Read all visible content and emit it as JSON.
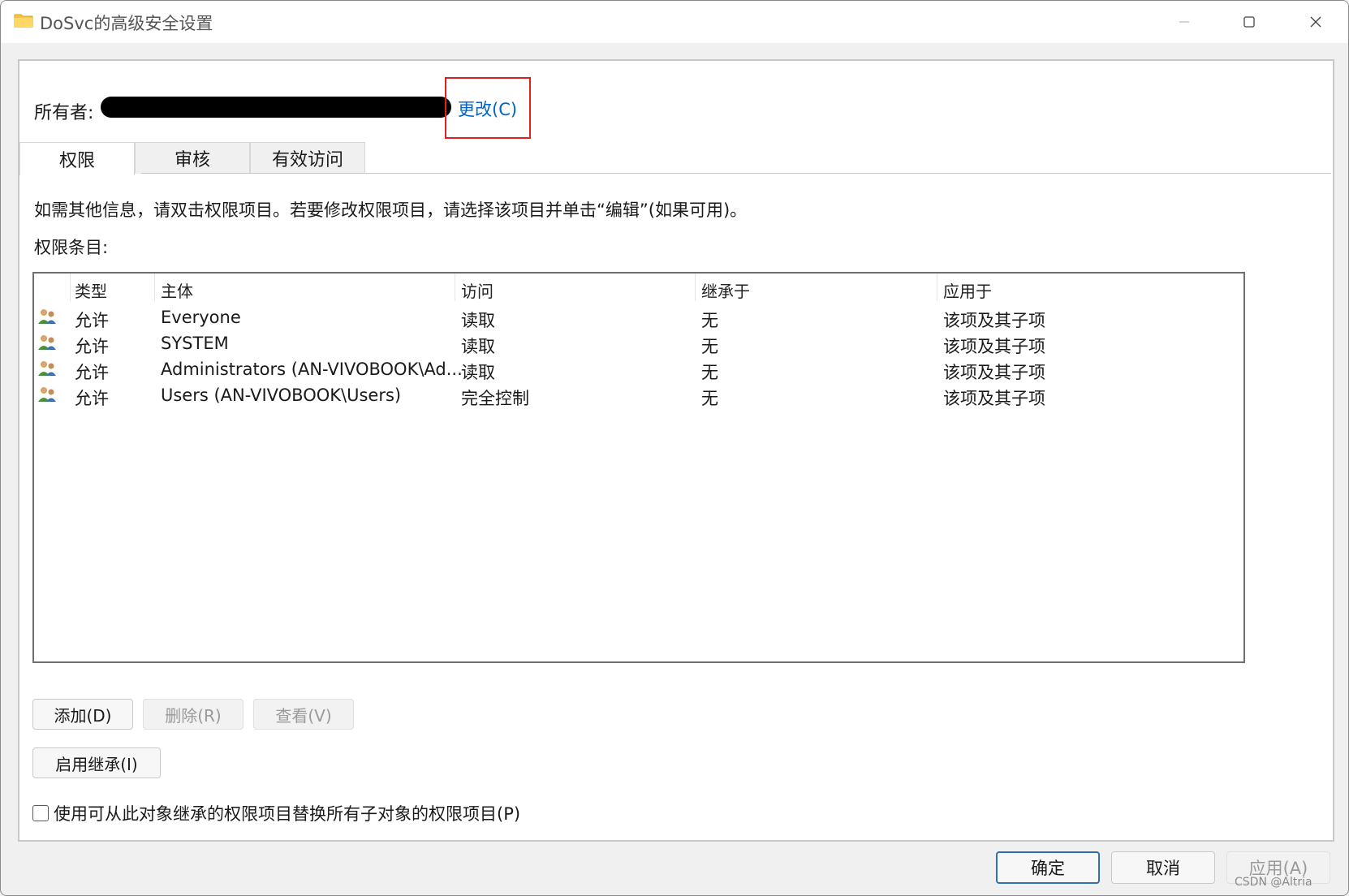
{
  "window": {
    "title": "DoSvc的高级安全设置"
  },
  "owner": {
    "label": "所有者:",
    "change_link": "更改(C)"
  },
  "tabs": [
    {
      "label": "权限",
      "active": true
    },
    {
      "label": "审核",
      "active": false
    },
    {
      "label": "有效访问",
      "active": false
    }
  ],
  "info_text": "如需其他信息，请双击权限项目。若要修改权限项目，请选择该项目并单击“编辑”(如果可用)。",
  "entries_label": "权限条目:",
  "table": {
    "columns": [
      "类型",
      "主体",
      "访问",
      "继承于",
      "应用于"
    ],
    "rows": [
      {
        "type": "允许",
        "principal": "Everyone",
        "access": "读取",
        "inherited": "无",
        "applies": "该项及其子项"
      },
      {
        "type": "允许",
        "principal": "SYSTEM",
        "access": "读取",
        "inherited": "无",
        "applies": "该项及其子项"
      },
      {
        "type": "允许",
        "principal": "Administrators (AN-VIVOBOOK\\Ad...",
        "access": "读取",
        "inherited": "无",
        "applies": "该项及其子项"
      },
      {
        "type": "允许",
        "principal": "Users (AN-VIVOBOOK\\Users)",
        "access": "完全控制",
        "inherited": "无",
        "applies": "该项及其子项"
      }
    ]
  },
  "buttons": {
    "add": "添加(D)",
    "remove": "删除(R)",
    "view": "查看(V)",
    "enable_inheritance": "启用继承(I)"
  },
  "replace_checkbox": {
    "label": "使用可从此对象继承的权限项目替换所有子对象的权限项目(P)",
    "checked": false
  },
  "footer": {
    "ok": "确定",
    "cancel": "取消",
    "apply": "应用(A)"
  },
  "watermark": "CSDN @Altria",
  "colors": {
    "link": "#0064c8",
    "highlight_box": "#e02020",
    "primary_border": "#2f6fb6"
  }
}
